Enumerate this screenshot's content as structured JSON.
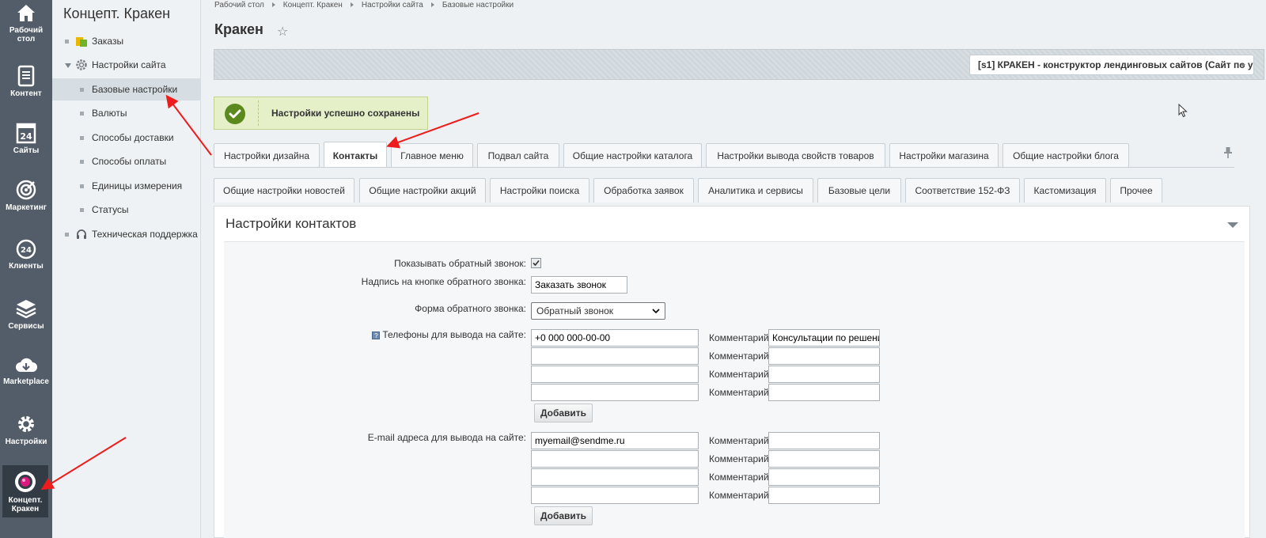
{
  "iconbar": {
    "items": [
      {
        "label": "Рабочий стол",
        "icon": "home-icon"
      },
      {
        "label": "Контент",
        "icon": "document-icon"
      },
      {
        "label": "Сайты",
        "icon": "calendar-24-icon"
      },
      {
        "label": "Маркетинг",
        "icon": "target-icon"
      },
      {
        "label": "Клиенты",
        "icon": "crm-24-icon"
      },
      {
        "label": "Сервисы",
        "icon": "layers-icon"
      },
      {
        "label": "Marketplace",
        "icon": "cloud-download-icon"
      },
      {
        "label": "Настройки",
        "icon": "gear-icon"
      },
      {
        "label": "Концепт. Кракен",
        "icon": "kraken-logo-icon"
      }
    ],
    "line1": {
      "home": "Рабочий",
      "kraken": "Концепт."
    },
    "line2": {
      "home": "стол",
      "kraken": "Кракен"
    }
  },
  "submenu": {
    "title": "Концепт. Кракен",
    "items": [
      {
        "label": "Заказы"
      },
      {
        "label": "Настройки сайта"
      },
      {
        "label": "Базовые настройки"
      },
      {
        "label": "Валюты"
      },
      {
        "label": "Способы доставки"
      },
      {
        "label": "Способы оплаты"
      },
      {
        "label": "Единицы измерения"
      },
      {
        "label": "Статусы"
      },
      {
        "label": "Техническая поддержка"
      }
    ]
  },
  "breadcrumb": [
    "Рабочий стол",
    "Концепт. Кракен",
    "Настройки сайта",
    "Базовые настройки"
  ],
  "page": {
    "title": "Кракен",
    "star": "☆"
  },
  "site_select": {
    "value": "[s1] КРАКЕН - конструктор лендинговых сайтов (Сайт по у"
  },
  "notification": {
    "text": "Настройки успешно сохранены"
  },
  "tabs_row1": [
    "Настройки дизайна",
    "Контакты",
    "Главное меню",
    "Подвал сайта",
    "Общие настройки каталога",
    "Настройки вывода свойств товаров",
    "Настройки магазина",
    "Общие настройки блога"
  ],
  "tabs_row2": [
    "Общие настройки новостей",
    "Общие настройки акций",
    "Настройки поиска",
    "Обработка заявок",
    "Аналитика и сервисы",
    "Базовые цели",
    "Соответствие 152-ФЗ",
    "Кастомизация",
    "Прочее"
  ],
  "active_tab": "Контакты",
  "panel": {
    "title": "Настройки контактов"
  },
  "form": {
    "callback_label": "Показывать обратный звонок:",
    "callback_checked": true,
    "button_text_label": "Надпись на кнопке обратного звонка:",
    "button_text_value": "Заказать звонок",
    "form_label": "Форма обратного звонка:",
    "form_value": "Обратный звонок",
    "phones_label": "Телефоны для вывода на сайте:",
    "phones": [
      "+0 000 000-00-00",
      "",
      "",
      ""
    ],
    "phone_comments": [
      "Консультации по решени",
      "",
      "",
      ""
    ],
    "comment_label": "Комментарий:",
    "add_button": "Добавить",
    "emails_label": "E-mail адреса для вывода на сайте:",
    "emails": [
      "myemail@sendme.ru",
      "",
      "",
      ""
    ],
    "email_comments": [
      "",
      "",
      "",
      ""
    ]
  },
  "colors": {
    "accent_arrow": "#ee1c1c",
    "success": "#5a8a1d",
    "iconbar": "#535c69"
  }
}
